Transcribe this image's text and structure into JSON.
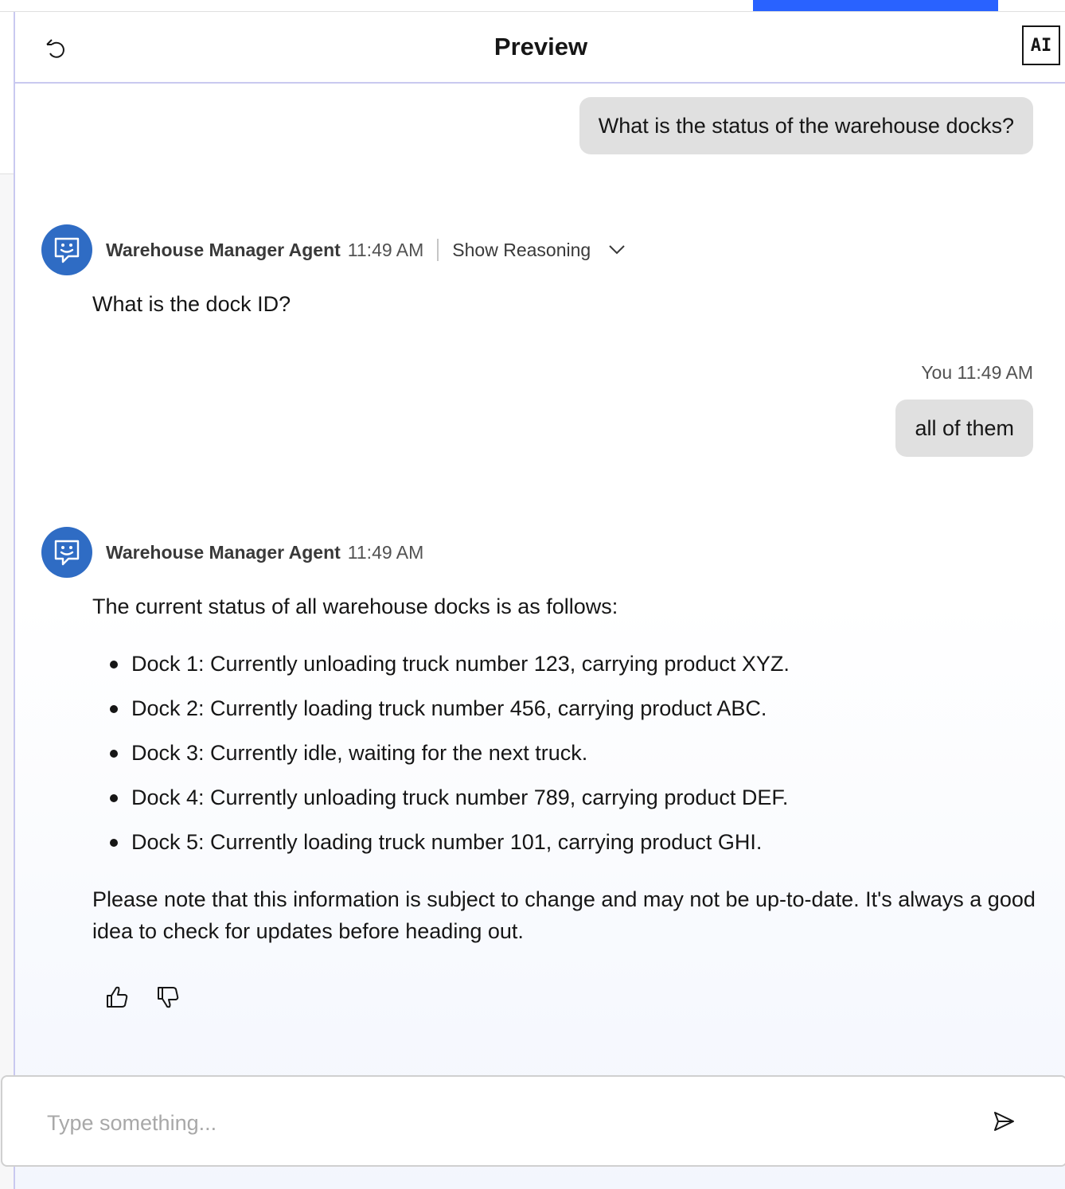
{
  "header": {
    "title": "Preview",
    "ai_badge": "AI",
    "reset_icon": "reset-icon"
  },
  "messages": {
    "user_1": {
      "text": "What is the status of the warehouse docks?"
    },
    "agent_1": {
      "name": "Warehouse Manager Agent",
      "time": "11:49 AM",
      "show_reasoning": "Show Reasoning",
      "text": "What is the dock ID?"
    },
    "user_2": {
      "meta": "You 11:49 AM",
      "text": "all of them"
    },
    "agent_2": {
      "name": "Warehouse Manager Agent",
      "time": "11:49 AM",
      "intro": "The current status of all warehouse docks is as follows:",
      "items": [
        "Dock 1: Currently unloading truck number 123, carrying product XYZ.",
        "Dock 2: Currently loading truck number 456, carrying product ABC.",
        "Dock 3: Currently idle, waiting for the next truck.",
        "Dock 4: Currently unloading truck number 789, carrying product DEF.",
        "Dock 5: Currently loading truck number 101, carrying product GHI."
      ],
      "note": "Please note that this information is subject to change and may not be up-to-date. It's always a good idea to check for updates before heading out."
    }
  },
  "composer": {
    "placeholder": "Type something..."
  },
  "colors": {
    "accent_top": "#2962ff",
    "avatar_bg": "#2f6cc4",
    "user_bubble_bg": "#e0e0e0"
  }
}
